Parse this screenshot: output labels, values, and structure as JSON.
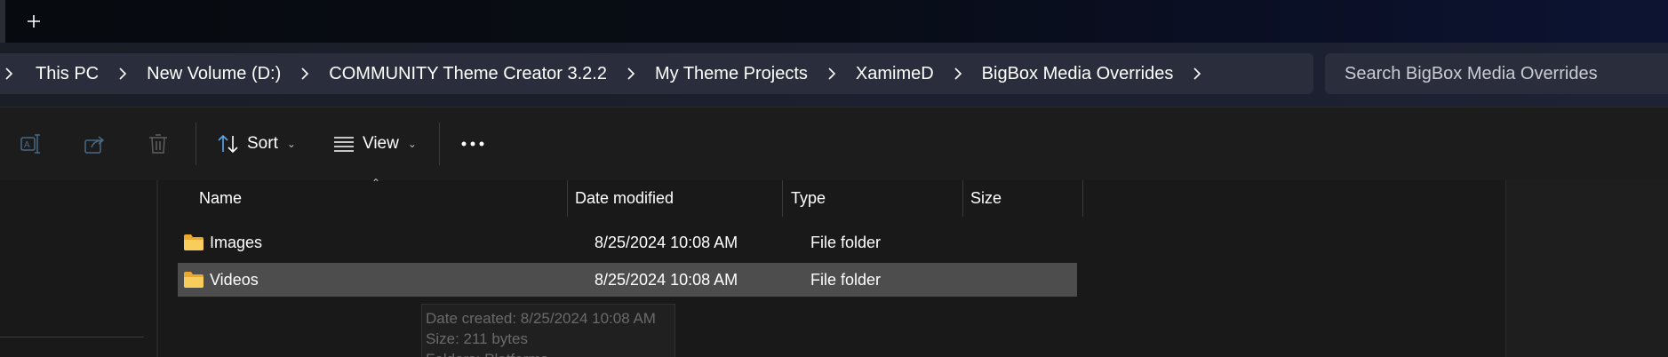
{
  "titlebar": {
    "new_tab_label": "+"
  },
  "breadcrumb": {
    "items": [
      "This PC",
      "New Volume (D:)",
      "COMMUNITY Theme Creator 3.2.2",
      "My Theme Projects",
      "XamimeD",
      "BigBox Media Overrides"
    ]
  },
  "search": {
    "placeholder": "Search BigBox Media Overrides"
  },
  "toolbar": {
    "sort_label": "Sort",
    "view_label": "View",
    "icons": [
      "rename-icon",
      "share-icon",
      "delete-icon",
      "sort-icon",
      "view-icon",
      "more-icon"
    ]
  },
  "columns": {
    "name": "Name",
    "date_modified": "Date modified",
    "type": "Type",
    "size": "Size"
  },
  "files": [
    {
      "name": "Images",
      "date_modified": "8/25/2024 10:08 AM",
      "type": "File folder",
      "size": "",
      "selected": false
    },
    {
      "name": "Videos",
      "date_modified": "8/25/2024 10:08 AM",
      "type": "File folder",
      "size": "",
      "selected": true
    }
  ],
  "tooltip": {
    "line1": "Date created: 8/25/2024 10:08 AM",
    "line2": "Size: 211 bytes",
    "line3": "Folders: Platforms"
  },
  "colors": {
    "accent_blue": "#5aa7e8",
    "folder_yellow": "#f5c24b",
    "selected_row": "#4d4d4d"
  }
}
